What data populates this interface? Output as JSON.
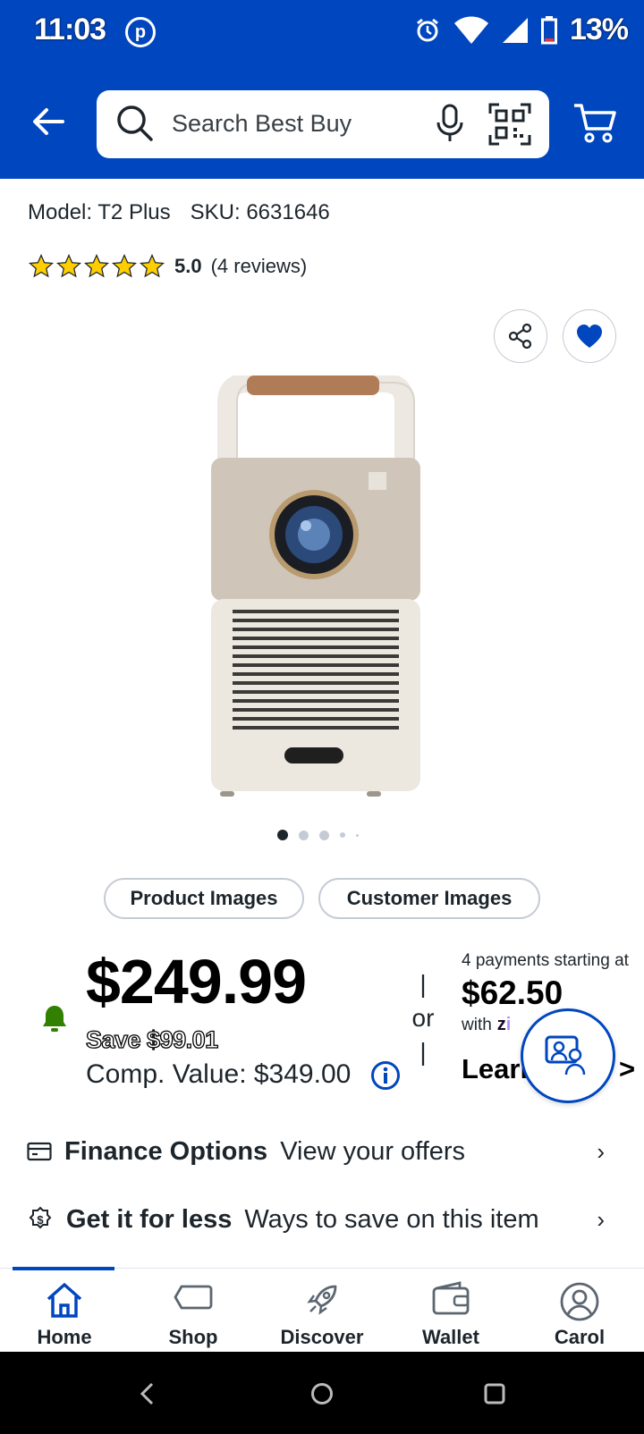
{
  "status_bar": {
    "time": "11:03",
    "battery": "13%"
  },
  "header": {
    "search_placeholder": "Search Best Buy"
  },
  "product": {
    "model": "Model: T2 Plus",
    "sku": "SKU: 6631646",
    "rating_value": "5.0",
    "review_count": "(4 reviews)",
    "stars": 5
  },
  "gallery": {
    "image_index": 1,
    "image_count": 5,
    "product_images_label": "Product Images",
    "customer_images_label": "Customer Images"
  },
  "pricing": {
    "price": "$249.99",
    "savings": "Save $99.01",
    "comp_value": "Comp. Value: $349.00",
    "or_label": "or",
    "installment_text": "4 payments starting at",
    "installment_amount": "$62.50",
    "with_label": "with",
    "provider": "zip",
    "learn_more": "Learn more",
    "learn_arrow": ">"
  },
  "options": [
    {
      "title": "Finance Options",
      "subtitle": "View your offers"
    },
    {
      "title": "Get it for less",
      "subtitle": "Ways to save on this item"
    }
  ],
  "bottom_nav": [
    {
      "label": "Home",
      "active": true
    },
    {
      "label": "Shop"
    },
    {
      "label": "Discover"
    },
    {
      "label": "Wallet"
    },
    {
      "label": "Carol"
    }
  ],
  "colors": {
    "brand_blue": "#0046be",
    "star_yellow": "#ffce00",
    "bell_green": "#318000"
  }
}
